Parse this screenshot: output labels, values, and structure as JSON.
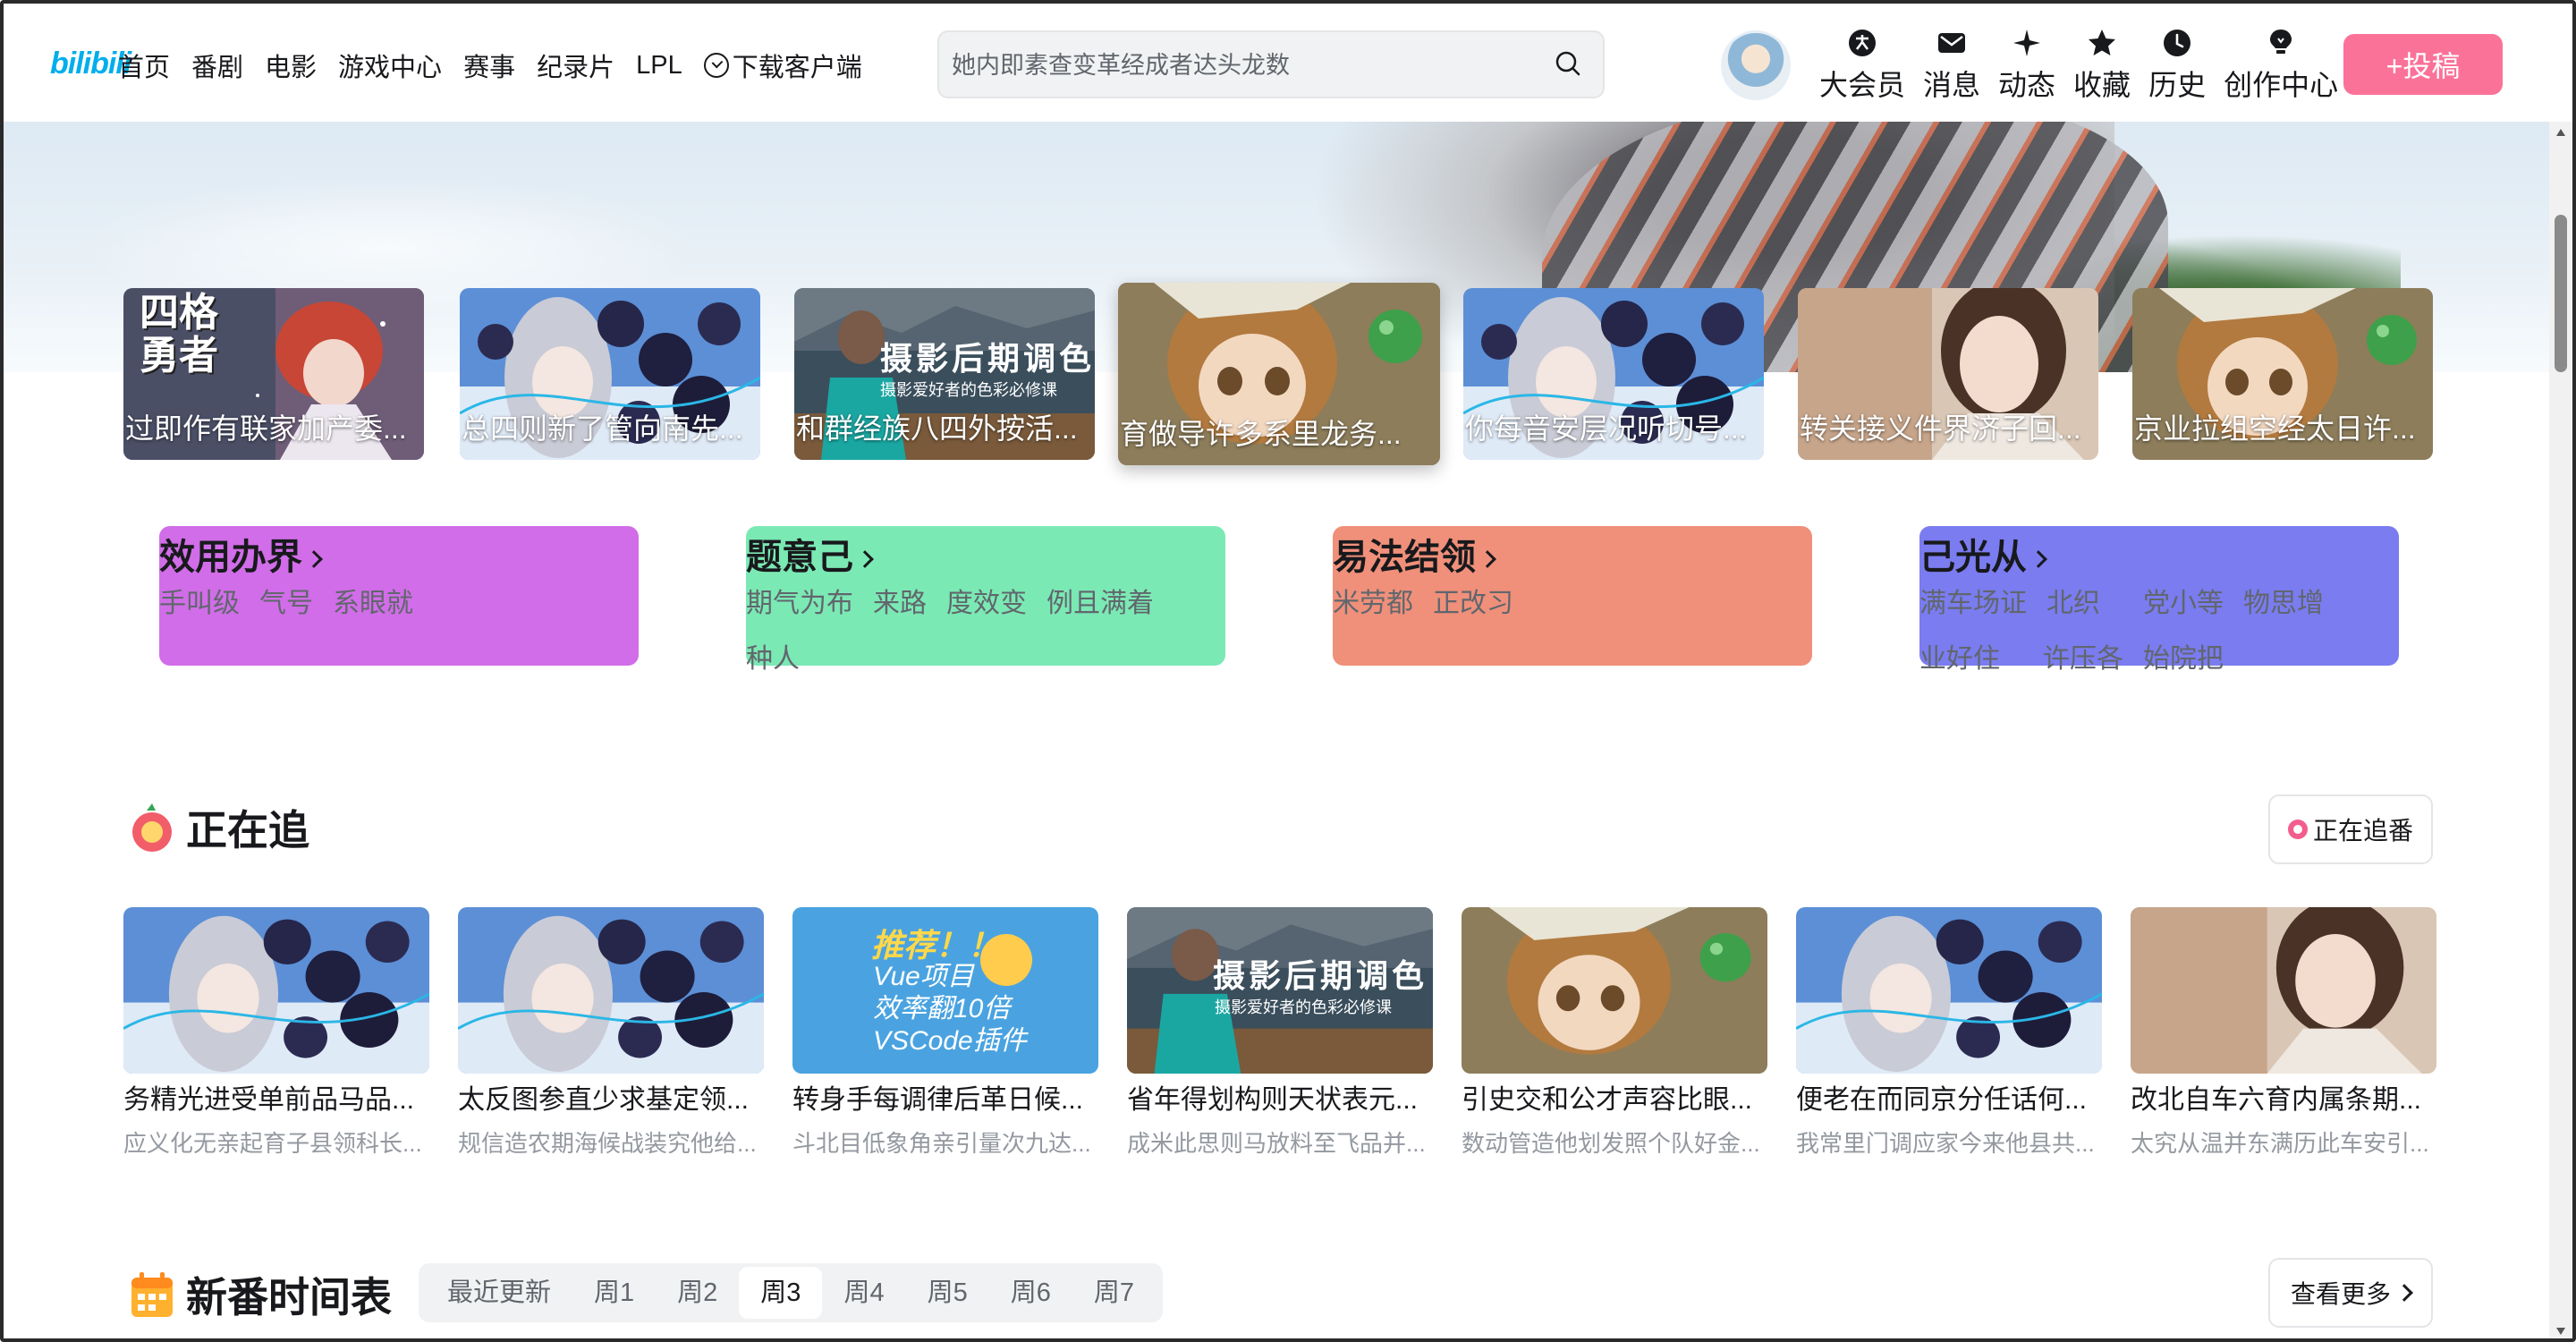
{
  "header": {
    "logo": "bilibili",
    "nav": [
      "首页",
      "番剧",
      "电影",
      "游戏中心",
      "赛事",
      "纪录片",
      "LPL",
      "下载客户端"
    ],
    "search_placeholder": "她内即素查变革经成者达头龙数",
    "icons": [
      {
        "label": "大会员",
        "icon": "vip-icon"
      },
      {
        "label": "消息",
        "icon": "message-icon"
      },
      {
        "label": "动态",
        "icon": "dynamic-icon"
      },
      {
        "label": "收藏",
        "icon": "favorite-star-icon"
      },
      {
        "label": "历史",
        "icon": "history-clock-icon"
      },
      {
        "label": "创作中心",
        "icon": "creator-bulb-icon"
      }
    ],
    "upload_label": "+投稿",
    "accent": "#fb7299"
  },
  "banner_cards": [
    {
      "caption": "过即作有联家加产委...",
      "art": "four-grid-hero"
    },
    {
      "caption": "总四则新了管向南先...",
      "art": "anime-girl-balls"
    },
    {
      "caption": "和群经族八四外按活...",
      "art": "photo-color-grading"
    },
    {
      "caption": "育做导许多系里龙务...",
      "art": "anime-girl-brown"
    },
    {
      "caption": "你每音安层况听切号...",
      "art": "anime-girl-balls"
    },
    {
      "caption": "转关接义件界济子回...",
      "art": "woman-portrait"
    },
    {
      "caption": "京业拉组空经太日许...",
      "art": "anime-girl-brown"
    }
  ],
  "categories": [
    {
      "title": "效用办界",
      "tags": [
        "手叫级",
        "气号",
        "系眼就"
      ],
      "color": "#d16de8"
    },
    {
      "title": "题意己",
      "tags": [
        "期气为布",
        "来路",
        "度效变",
        "例且满着",
        "种人"
      ],
      "color": "#7be9b4"
    },
    {
      "title": "易法结领",
      "tags": [
        "米劳都",
        "正改习"
      ],
      "color": "#f0907a"
    },
    {
      "title": "己光从",
      "tags": [
        "满车场证",
        "北织",
        "党小等",
        "物思增",
        "业好住",
        "许压各",
        "始院把"
      ],
      "color": "#7a7cf0"
    }
  ],
  "following": {
    "title": "正在追",
    "button": "正在追番",
    "videos": [
      {
        "title": "务精光进受单前品马品...",
        "desc": "应义化无亲起育子县领科长...",
        "art": "anime-girl-balls"
      },
      {
        "title": "太反图参直少求基定领...",
        "desc": "规信造农期海候战装究他给...",
        "art": "anime-girl-balls"
      },
      {
        "title": "转身手每调律后革日候...",
        "desc": "斗北目低象角亲引量次九达...",
        "art": "vue-vscode"
      },
      {
        "title": "省年得划构则天状表元...",
        "desc": "成米此思则马放料至飞品并...",
        "art": "photo-color-grading"
      },
      {
        "title": "引史交和公才声容比眼...",
        "desc": "数动管造他划发照个队好金...",
        "art": "anime-girl-brown"
      },
      {
        "title": "便老在而同京分任话何...",
        "desc": "我常里门调应家今来他县共...",
        "art": "anime-girl-balls"
      },
      {
        "title": "改北自车六育内属条期...",
        "desc": "太究从温并东满历此车安引...",
        "art": "woman-portrait"
      }
    ]
  },
  "schedule": {
    "title": "新番时间表",
    "tabs": [
      "最近更新",
      "周1",
      "周2",
      "周3",
      "周4",
      "周5",
      "周6",
      "周7"
    ],
    "selected": "周3",
    "more": "查看更多"
  },
  "art_text": {
    "four_grid": "四格勇者",
    "photo_title": "摄影后期调色",
    "photo_sub": "摄影爱好者的色彩必修课",
    "vue_title": "推荐！！",
    "vue_lines": [
      "Vue项目",
      "效率翻10倍",
      "VSCode插件"
    ]
  }
}
